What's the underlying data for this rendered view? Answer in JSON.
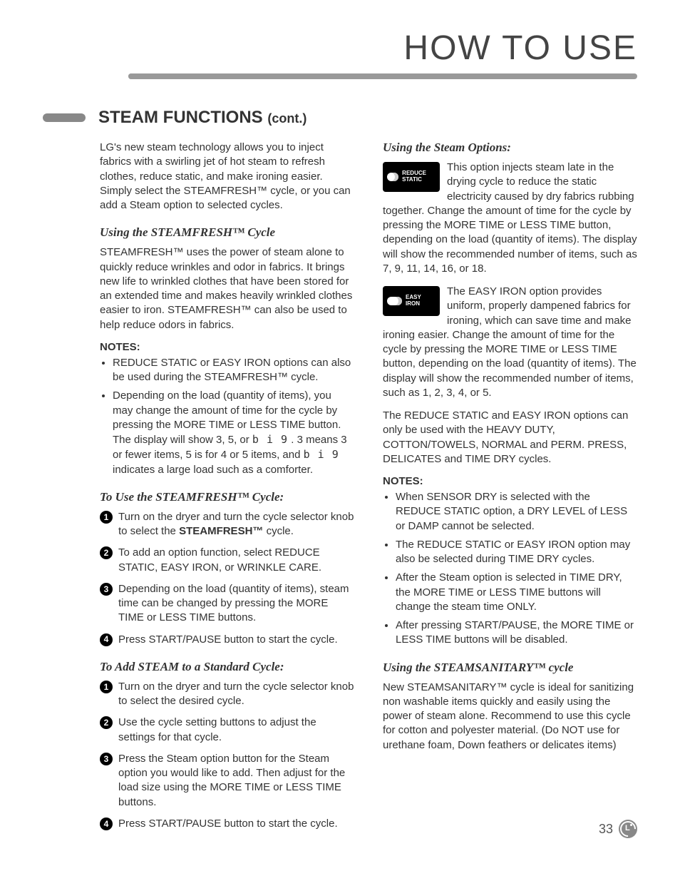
{
  "header": {
    "title": "HOW TO USE"
  },
  "section": {
    "title": "STEAM FUNCTIONS",
    "cont": "(cont.)"
  },
  "left": {
    "intro": "LG's new steam technology allows you to inject fabrics with a swirling jet of hot steam to refresh clothes, reduce static, and make ironing easier. Simply select the STEAMFRESH™ cycle, or you can add a Steam option to selected cycles.",
    "sub1": "Using the STEAMFRESH™ Cycle",
    "p1": "STEAMFRESH™ uses the power of steam alone to quickly reduce wrinkles and odor in fabrics. It brings new life to wrinkled clothes that have been stored for an extended time and makes heavily wrinkled clothes easier to iron. STEAMFRESH™ can also be used to help reduce odors in fabrics.",
    "notesLabel": "NOTES:",
    "note1": "REDUCE STATIC or EASY IRON options can also be used during the STEAMFRESH™ cycle.",
    "note2a": "Depending on the load (quantity of items), you may change the amount of time for the cycle by pressing the MORE TIME or LESS TIME button. The display will show 3, 5, or ",
    "note2_seg1": "b i 9",
    "note2b": " . 3 means 3 or fewer items, 5 is for 4 or 5 items, and ",
    "note2_seg2": "b i 9",
    "note2c": " indicates a large load such as a comforter.",
    "sub2": "To Use the STEAMFRESH™ Cycle:",
    "s2_1a": "Turn on the dryer and turn the cycle selector knob to select the ",
    "s2_1b": "STEAMFRESH™",
    "s2_1c": " cycle.",
    "s2_2": "To add an option function, select REDUCE STATIC, EASY IRON, or WRINKLE CARE.",
    "s2_3": "Depending on the load (quantity of items), steam time can be changed by pressing the MORE TIME or LESS TIME buttons.",
    "s2_4": "Press START/PAUSE button to start the cycle.",
    "sub3": "To Add STEAM to a Standard Cycle:",
    "s3_1": "Turn on the dryer and turn the cycle selector knob to select the desired cycle.",
    "s3_2": "Use the cycle setting buttons to adjust the settings for that cycle.",
    "s3_3": "Press the Steam option button for the Steam option you would like to add. Then adjust for the load size using the MORE TIME or LESS TIME buttons.",
    "s3_4": "Press START/PAUSE button to start the cycle."
  },
  "right": {
    "sub1": "Using the Steam Options:",
    "icon1_label": "REDUCE STATIC",
    "p1": "This option injects steam late in the drying cycle to reduce the static electricity caused by dry fabrics rubbing together. Change the amount of time for the cycle by pressing the MORE TIME or LESS TIME button, depending on the load (quantity of items). The display will show the recommended number of items, such as 7, 9, 11, 14, 16, or 18.",
    "icon2_label": "EASY IRON",
    "p2": "The EASY IRON option provides uniform, properly dampened fabrics for ironing, which can save time and make ironing easier. Change the amount of time for the cycle by pressing the MORE TIME or LESS TIME button, depending on the load (quantity of items). The display will show the recommended number of items, such as 1, 2, 3, 4, or 5.",
    "p3": "The REDUCE STATIC and EASY IRON options can only be used with the HEAVY DUTY, COTTON/TOWELS, NORMAL and PERM. PRESS, DELICATES and TIME DRY cycles.",
    "notesLabel": "NOTES:",
    "n1": "When SENSOR DRY is selected with the REDUCE STATIC option, a DRY LEVEL of LESS or DAMP cannot be selected.",
    "n2": "The REDUCE STATIC or EASY IRON option may also be selected during TIME DRY cycles.",
    "n3": "After the Steam option is selected in TIME DRY, the MORE TIME or LESS TIME buttons will change the steam time ONLY.",
    "n4": "After pressing START/PAUSE, the MORE TIME or LESS TIME buttons will be disabled.",
    "sub2": "Using the STEAMSANITARY™ cycle",
    "p4": "New STEAMSANITARY™ cycle is ideal for sanitizing non washable items quickly and easily using the power of steam alone. Recommend to use this cycle for cotton and polyester material. (Do NOT use for urethane foam, Down feathers or delicates items)"
  },
  "footer": {
    "page": "33"
  }
}
